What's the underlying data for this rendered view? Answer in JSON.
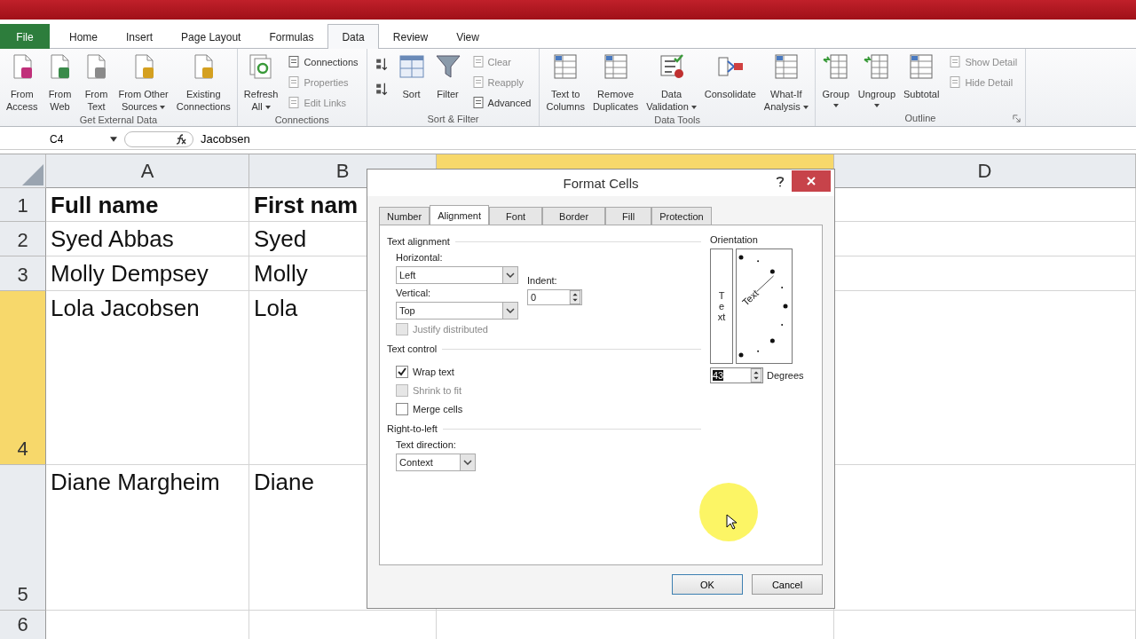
{
  "ribbon_tabs": [
    {
      "label": "File",
      "kind": "file",
      "selected": false
    },
    {
      "label": "Home",
      "kind": "tab",
      "selected": false
    },
    {
      "label": "Insert",
      "kind": "tab",
      "selected": false
    },
    {
      "label": "Page Layout",
      "kind": "tab",
      "selected": false
    },
    {
      "label": "Formulas",
      "kind": "tab",
      "selected": false
    },
    {
      "label": "Data",
      "kind": "tab",
      "selected": true
    },
    {
      "label": "Review",
      "kind": "tab",
      "selected": false
    },
    {
      "label": "View",
      "kind": "tab",
      "selected": false
    }
  ],
  "ribbon_groups": [
    {
      "label": "Get External Data",
      "launcher": false,
      "items": [
        {
          "kind": "large",
          "lines": [
            "From",
            "Access"
          ],
          "dropdown": false
        },
        {
          "kind": "large",
          "lines": [
            "From",
            "Web"
          ],
          "dropdown": false
        },
        {
          "kind": "large",
          "lines": [
            "From",
            "Text"
          ],
          "dropdown": false
        },
        {
          "kind": "large",
          "lines": [
            "From Other",
            "Sources"
          ],
          "dropdown": true
        },
        {
          "kind": "large",
          "lines": [
            "Existing",
            "Connections"
          ],
          "dropdown": false
        }
      ]
    },
    {
      "label": "Connections",
      "launcher": false,
      "items": [
        {
          "kind": "large",
          "lines": [
            "Refresh",
            "All"
          ],
          "dropdown": true
        },
        {
          "kind": "stack",
          "entries": [
            {
              "kind": "small",
              "label": "Connections",
              "disabled": false
            },
            {
              "kind": "small",
              "label": "Properties",
              "disabled": true
            },
            {
              "kind": "small",
              "label": "Edit Links",
              "disabled": true
            }
          ]
        }
      ]
    },
    {
      "label": "Sort & Filter",
      "launcher": false,
      "items": [
        {
          "kind": "stack",
          "entries": [
            {
              "kind": "icon",
              "disabled": false
            },
            {
              "kind": "icon",
              "disabled": false
            }
          ]
        },
        {
          "kind": "large",
          "lines": [
            "Sort"
          ],
          "dropdown": false
        },
        {
          "kind": "large",
          "lines": [
            "Filter"
          ],
          "dropdown": false
        },
        {
          "kind": "stack",
          "entries": [
            {
              "kind": "small",
              "label": "Clear",
              "disabled": true
            },
            {
              "kind": "small",
              "label": "Reapply",
              "disabled": true
            },
            {
              "kind": "small",
              "label": "Advanced",
              "disabled": false
            }
          ]
        }
      ]
    },
    {
      "label": "Data Tools",
      "launcher": false,
      "items": [
        {
          "kind": "large",
          "lines": [
            "Text to",
            "Columns"
          ],
          "dropdown": false
        },
        {
          "kind": "large",
          "lines": [
            "Remove",
            "Duplicates"
          ],
          "dropdown": false
        },
        {
          "kind": "large",
          "lines": [
            "Data",
            "Validation"
          ],
          "dropdown": true
        },
        {
          "kind": "large",
          "lines": [
            "Consolidate"
          ],
          "dropdown": false
        },
        {
          "kind": "large",
          "lines": [
            "What-If",
            "Analysis"
          ],
          "dropdown": true
        }
      ]
    },
    {
      "label": "Outline",
      "launcher": true,
      "items": [
        {
          "kind": "large",
          "lines": [
            "Group"
          ],
          "dropdown": true
        },
        {
          "kind": "large",
          "lines": [
            "Ungroup"
          ],
          "dropdown": true
        },
        {
          "kind": "large",
          "lines": [
            "Subtotal"
          ],
          "dropdown": false
        },
        {
          "kind": "stack",
          "entries": [
            {
              "kind": "small",
              "label": "Show Detail",
              "disabled": true
            },
            {
              "kind": "small",
              "label": "Hide Detail",
              "disabled": true
            }
          ]
        }
      ]
    }
  ],
  "formula_bar": {
    "name_box": "C4",
    "formula": "Jacobsen"
  },
  "sheet": {
    "columns": [
      {
        "label": "A",
        "selected": false
      },
      {
        "label": "B",
        "selected": false
      },
      {
        "selected": true
      },
      {
        "label": "D",
        "selected": false
      }
    ],
    "rows": [
      {
        "label": "1",
        "selected": false,
        "bold": true,
        "cells": [
          "Full name",
          "First nam"
        ]
      },
      {
        "label": "2",
        "selected": false,
        "bold": false,
        "cells": [
          "Syed Abbas",
          "Syed"
        ]
      },
      {
        "label": "3",
        "selected": false,
        "bold": false,
        "cells": [
          "Molly Dempsey",
          "Molly"
        ]
      },
      {
        "label": "4",
        "selected": true,
        "bold": false,
        "cells": [
          "Lola Jacobsen",
          "Lola"
        ]
      },
      {
        "label": "5",
        "selected": false,
        "bold": false,
        "cells": [
          "Diane Margheim",
          "Diane"
        ]
      },
      {
        "label": "6",
        "selected": false,
        "cells": []
      }
    ]
  },
  "dialog": {
    "title": "Format Cells",
    "tabs": [
      {
        "label": "Number",
        "selected": false
      },
      {
        "label": "Alignment",
        "selected": true
      },
      {
        "label": "Font",
        "selected": false
      },
      {
        "label": "Border",
        "selected": false
      },
      {
        "label": "Fill",
        "selected": false
      },
      {
        "label": "Protection",
        "selected": false
      }
    ],
    "text_alignment": {
      "heading": "Text alignment",
      "horizontal": {
        "label": "Horizontal:",
        "value": "Left"
      },
      "vertical": {
        "label": "Vertical:",
        "value": "Top"
      },
      "indent": {
        "label": "Indent:",
        "value": "0"
      },
      "justify_distributed": {
        "label": "Justify distributed",
        "checked": false,
        "disabled": true
      }
    },
    "text_control": {
      "heading": "Text control",
      "options": [
        {
          "label": "Wrap text",
          "checked": true,
          "disabled": false
        },
        {
          "label": "Shrink to fit",
          "checked": false,
          "disabled": true
        },
        {
          "label": "Merge cells",
          "checked": false,
          "disabled": false
        }
      ]
    },
    "right_to_left": {
      "heading": "Right-to-left",
      "text_direction": {
        "label": "Text direction:",
        "value": "Context"
      }
    },
    "orientation": {
      "heading": "Orientation",
      "vertical_text": "Text",
      "dial_text": "Text",
      "degrees": {
        "value": "43",
        "label": "Degrees"
      }
    },
    "buttons": [
      {
        "label": "OK",
        "default": true
      },
      {
        "label": "Cancel",
        "default": false
      }
    ]
  }
}
